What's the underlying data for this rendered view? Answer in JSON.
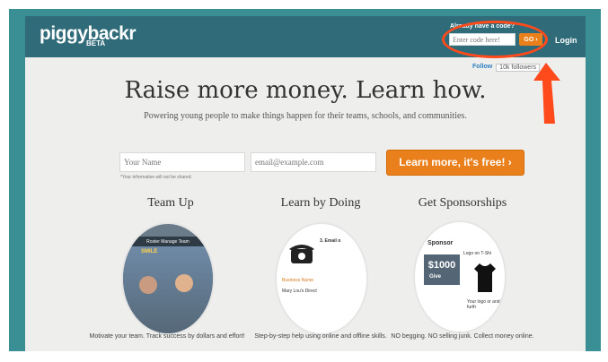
{
  "header": {
    "logo": "piggybackr",
    "beta": "BETA",
    "code_label": "Already have a code?",
    "code_placeholder": "Enter code here!",
    "go": "GO ›",
    "login": "Login"
  },
  "social": {
    "follow": "Follow",
    "followers": "10k followers"
  },
  "hero": {
    "headline": "Raise more money. Learn how.",
    "subhead": "Powering young people to make things happen for their teams, schools, and communities."
  },
  "form": {
    "name_placeholder": "Your Name",
    "email_placeholder": "email@example.com",
    "note": "*Your information will not be shared.",
    "cta": "Learn more, it's free! ›"
  },
  "features": [
    {
      "title": "Team Up",
      "caption": "Motivate your team. Track success by dollars and effort!"
    },
    {
      "title": "Learn by Doing",
      "caption": "Step-by-step help using online and offline skills."
    },
    {
      "title": "Get Sponsorships",
      "caption": "NO begging. NO selling junk. Collect money online."
    }
  ],
  "illustrations": {
    "team_bar": "Roster   Manage Team",
    "team_smile": "SMILE",
    "learn_email": "3. Email o",
    "learn_biz": "Business Name",
    "learn_biz2": "Mary Lou's Direct",
    "sponsor_title": "Sponsor",
    "sponsor_amount": "$1000",
    "sponsor_give": "Give",
    "sponsor_logo_shirt": "Logo on T-Shi",
    "sponsor_yourlogo": "Your logo or and furth"
  },
  "colors": {
    "topbar": "#2f6b79",
    "accent": "#e9801b",
    "annotation": "#ff4a1c"
  }
}
